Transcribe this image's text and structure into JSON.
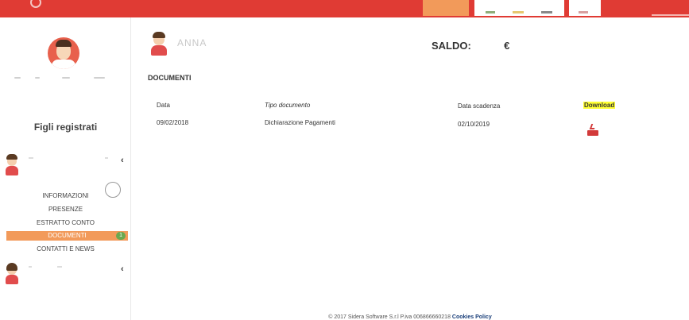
{
  "header": {
    "icons": [
      "logo-icon"
    ],
    "colors": {
      "bar": "#e03b34",
      "accent": "#f29a5a"
    }
  },
  "sidebar": {
    "section_title": "Figli registrati",
    "children": [
      {
        "chevron": "‹"
      },
      {
        "chevron": "‹"
      }
    ],
    "menu": [
      {
        "label": "INFORMAZIONI"
      },
      {
        "label": "PRESENZE"
      },
      {
        "label": "ESTRATTO CONTO"
      },
      {
        "label": "DOCUMENTI",
        "active": true,
        "badge": "1"
      },
      {
        "label": "CONTATTI E NEWS"
      }
    ]
  },
  "main": {
    "user_name": "ANNA",
    "saldo_label": "SALDO:",
    "saldo_currency": "€",
    "section_title": "DOCUMENTI",
    "table": {
      "headers": {
        "data": "Data",
        "tipo": "Tipo documento",
        "scadenza": "Data scadenza",
        "download": "Download"
      },
      "rows": [
        {
          "data": "09/02/2018",
          "tipo": "Dichiarazione Pagamenti",
          "scadenza": "02/10/2019",
          "download_icon": "pdf-download-icon"
        }
      ]
    }
  },
  "footer": {
    "text": "© 2017 Sidera Software S.r.l P.iva 006866660218",
    "link": "Cookies Policy"
  }
}
